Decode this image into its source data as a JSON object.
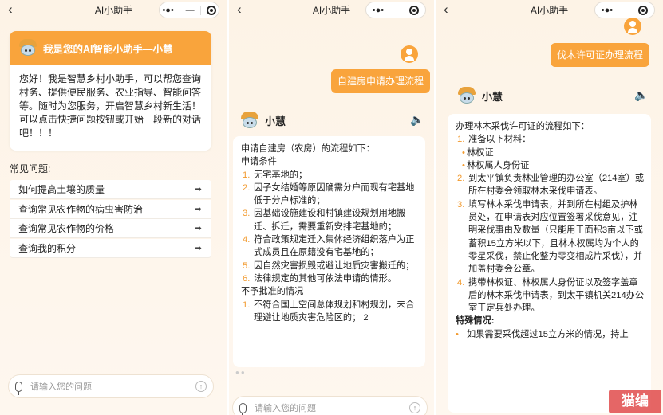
{
  "p1": {
    "title": "AI小助手",
    "welcome_title": "我是您的AI智能小助手—小慧",
    "welcome_text": "您好！我是智慧乡村小助手，可以帮您查询村务、提供便民服务、农业指导、智能问答等。随时为您服务，开启智慧乡村新生活！可以点击快捷问题按钮或开始一段新的对话吧！！！",
    "faq_label": "常见问题:",
    "faqs": [
      "如何提高土壤的质量",
      "查询常见农作物的病虫害防治",
      "查询常见农作物的价格",
      "查询我的积分"
    ],
    "input_placeholder": "请输入您的问题"
  },
  "p2": {
    "title": "AI小助手",
    "user_msg": "自建房申请办理流程",
    "bot_name": "小慧",
    "lines": [
      "申请自建房（农房）的流程如下：",
      "申请条件"
    ],
    "items": [
      {
        "n": "1.",
        "t": "无宅基地的；"
      },
      {
        "n": "2.",
        "t": "因子女结婚等原因确需分户而现有宅基地低于分户标准的；"
      },
      {
        "n": "3.",
        "t": "因基础设施建设和村镇建设规划用地搬迁、拆迁，需要重新安排宅基地的；"
      },
      {
        "n": "4.",
        "t": "符合政策规定迁入集体经济组织落户为正式成员且在原籍没有宅基地的；"
      },
      {
        "n": "5.",
        "t": "因自然灾害损毁或避让地质灾害搬迁的；"
      },
      {
        "n": "6.",
        "t": "法律规定的其他可依法申请的情形。"
      }
    ],
    "deny_label": "不予批准的情况",
    "deny_items": [
      {
        "n": "1.",
        "t": "不符合国土空间总体规划和村规划，未合理避让地质灾害危险区的；  2"
      }
    ],
    "input_placeholder": "请输入您的问题"
  },
  "p3": {
    "title": "AI小助手",
    "user_msg": "伐木许可证办理流程",
    "bot_name": "小慧",
    "intro": "办理林木采伐许可证的流程如下：",
    "step1": "准备以下材料：",
    "materials": [
      "林权证",
      "林权属人身份证"
    ],
    "step2": "到太平镇负责林业管理的办公室（214室）或所在村委会领取林木采伐申请表。",
    "step3": "填写林木采伐申请表，并到所在村组及护林员处，在申请表对应位置签署采伐意见，注明采伐事由及数量（只能用于面积3亩以下或蓄积15立方米以下，且林木权属均为个人的零星采伐，禁止化整为零变相成片采伐），并加盖村委会公章。",
    "step4": "携带林权证、林权属人身份证以及签字盖章后的林木采伐申请表，到太平镇机关214办公室王定兵处办理。",
    "special": "特殊情况:",
    "special_item": "如果需要采伐超过15立方米的情况，持上",
    "nums": [
      "1.",
      "2.",
      "3.",
      "4."
    ]
  },
  "watermark": "猫编"
}
